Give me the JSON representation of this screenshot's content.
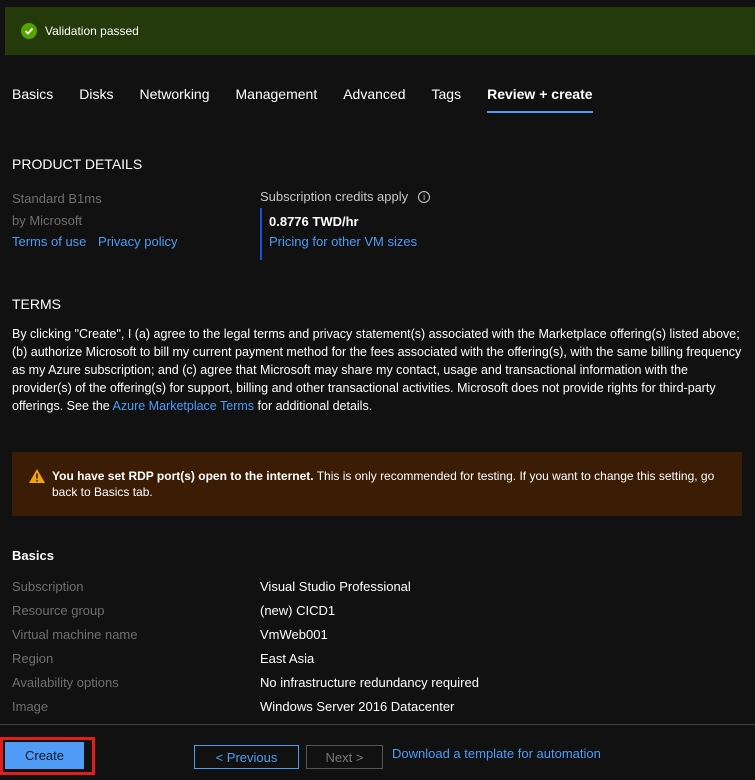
{
  "validation": {
    "text": "Validation passed"
  },
  "tabs": [
    {
      "label": "Basics"
    },
    {
      "label": "Disks"
    },
    {
      "label": "Networking"
    },
    {
      "label": "Management"
    },
    {
      "label": "Advanced"
    },
    {
      "label": "Tags"
    },
    {
      "label": "Review + create"
    }
  ],
  "product": {
    "heading": "PRODUCT DETAILS",
    "name": "Standard B1ms",
    "by": "by Microsoft",
    "terms_link": "Terms of use",
    "privacy_link": "Privacy policy",
    "credits_label": "Subscription credits apply",
    "price": "0.8776 TWD/hr",
    "pricing_link": "Pricing for other VM sizes"
  },
  "terms": {
    "heading": "TERMS",
    "text_before": "By clicking \"Create\", I (a) agree to the legal terms and privacy statement(s) associated with the Marketplace offering(s) listed above; (b) authorize Microsoft to bill my current payment method for the fees associated with the offering(s), with the same billing frequency as my Azure subscription; and (c) agree that Microsoft may share my contact, usage and transactional information with the provider(s) of the offering(s) for support, billing and other transactional activities. Microsoft does not provide rights for third-party offerings. See the ",
    "link": "Azure Marketplace Terms",
    "text_after": " for additional details."
  },
  "warning": {
    "bold": "You have set RDP port(s) open to the internet.",
    "text": " This is only recommended for testing.  If you want to change this setting, go back to Basics tab."
  },
  "basics": {
    "heading": "Basics",
    "rows": [
      {
        "key": "Subscription",
        "value": "Visual Studio Professional"
      },
      {
        "key": "Resource group",
        "value": "(new) CICD1"
      },
      {
        "key": "Virtual machine name",
        "value": "VmWeb001"
      },
      {
        "key": "Region",
        "value": "East Asia"
      },
      {
        "key": "Availability options",
        "value": "No infrastructure redundancy required"
      },
      {
        "key": "Image",
        "value": "Windows Server 2016 Datacenter"
      }
    ]
  },
  "footer": {
    "create": "Create",
    "previous": "< Previous",
    "next": "Next >",
    "download": "Download a template for automation"
  },
  "colors": {
    "accent": "#4f9bf5",
    "success": "#57a300",
    "warning": "#f0a30a",
    "highlight": "#e01e1e"
  }
}
